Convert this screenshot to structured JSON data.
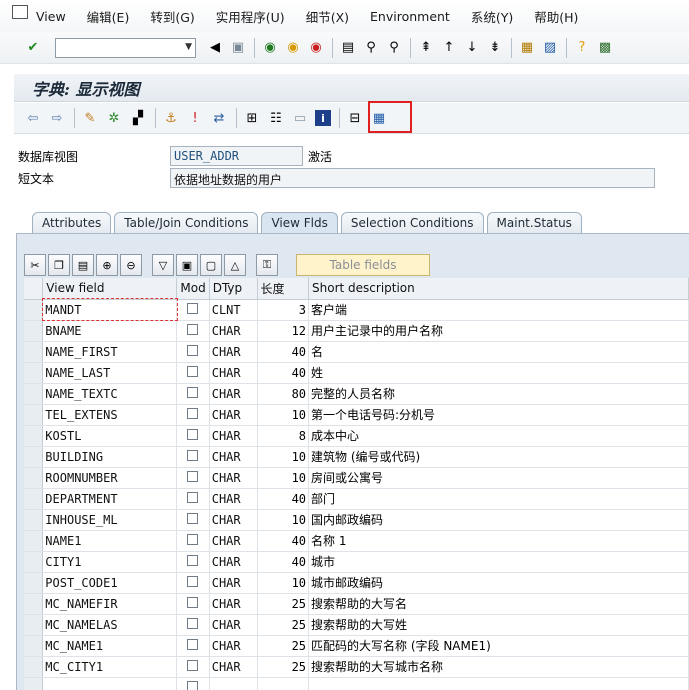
{
  "menu": {
    "items": [
      "View",
      "编辑(E)",
      "转到(G)",
      "实用程序(U)",
      "细节(X)",
      "Environment",
      "系统(Y)",
      "帮助(H)"
    ]
  },
  "toolbar": {
    "command_value": ""
  },
  "title": "字典: 显示视图",
  "header": {
    "view_label": "数据库视图",
    "view_value": "USER_ADDR",
    "status": "激活",
    "short_text_label": "短文本",
    "short_text_value": "依据地址数据的用户"
  },
  "tabs": [
    "Attributes",
    "Table/Join Conditions",
    "View Flds",
    "Selection Conditions",
    "Maint.Status"
  ],
  "active_tab": "View Flds",
  "panel": {
    "table_fields_label": "Table fields"
  },
  "grid": {
    "columns": [
      "View field",
      "Mod",
      "DTyp",
      "长度",
      "Short description"
    ],
    "rows": [
      {
        "field": "MANDT",
        "dtyp": "CLNT",
        "len": "3",
        "desc": "客户端"
      },
      {
        "field": "BNAME",
        "dtyp": "CHAR",
        "len": "12",
        "desc": "用户主记录中的用户名称"
      },
      {
        "field": "NAME_FIRST",
        "dtyp": "CHAR",
        "len": "40",
        "desc": "名"
      },
      {
        "field": "NAME_LAST",
        "dtyp": "CHAR",
        "len": "40",
        "desc": "姓"
      },
      {
        "field": "NAME_TEXTC",
        "dtyp": "CHAR",
        "len": "80",
        "desc": "完整的人员名称"
      },
      {
        "field": "TEL_EXTENS",
        "dtyp": "CHAR",
        "len": "10",
        "desc": "第一个电话号码:分机号"
      },
      {
        "field": "KOSTL",
        "dtyp": "CHAR",
        "len": "8",
        "desc": "成本中心"
      },
      {
        "field": "BUILDING",
        "dtyp": "CHAR",
        "len": "10",
        "desc": "建筑物 (编号或代码)"
      },
      {
        "field": "ROOMNUMBER",
        "dtyp": "CHAR",
        "len": "10",
        "desc": "房间或公寓号"
      },
      {
        "field": "DEPARTMENT",
        "dtyp": "CHAR",
        "len": "40",
        "desc": "部门"
      },
      {
        "field": "INHOUSE_ML",
        "dtyp": "CHAR",
        "len": "10",
        "desc": "国内邮政编码"
      },
      {
        "field": "NAME1",
        "dtyp": "CHAR",
        "len": "40",
        "desc": "名称 1"
      },
      {
        "field": "CITY1",
        "dtyp": "CHAR",
        "len": "40",
        "desc": "城市"
      },
      {
        "field": "POST_CODE1",
        "dtyp": "CHAR",
        "len": "10",
        "desc": "城市邮政编码"
      },
      {
        "field": "MC_NAMEFIR",
        "dtyp": "CHAR",
        "len": "25",
        "desc": "搜索帮助的大写名"
      },
      {
        "field": "MC_NAMELAS",
        "dtyp": "CHAR",
        "len": "25",
        "desc": "搜索帮助的大写姓"
      },
      {
        "field": "MC_NAME1",
        "dtyp": "CHAR",
        "len": "25",
        "desc": "匹配码的大写名称 (字段 NAME1)"
      },
      {
        "field": "MC_CITY1",
        "dtyp": "CHAR",
        "len": "25",
        "desc": "搜索帮助的大写城市名称"
      },
      {
        "field": "",
        "dtyp": "",
        "len": "",
        "desc": ""
      }
    ]
  }
}
